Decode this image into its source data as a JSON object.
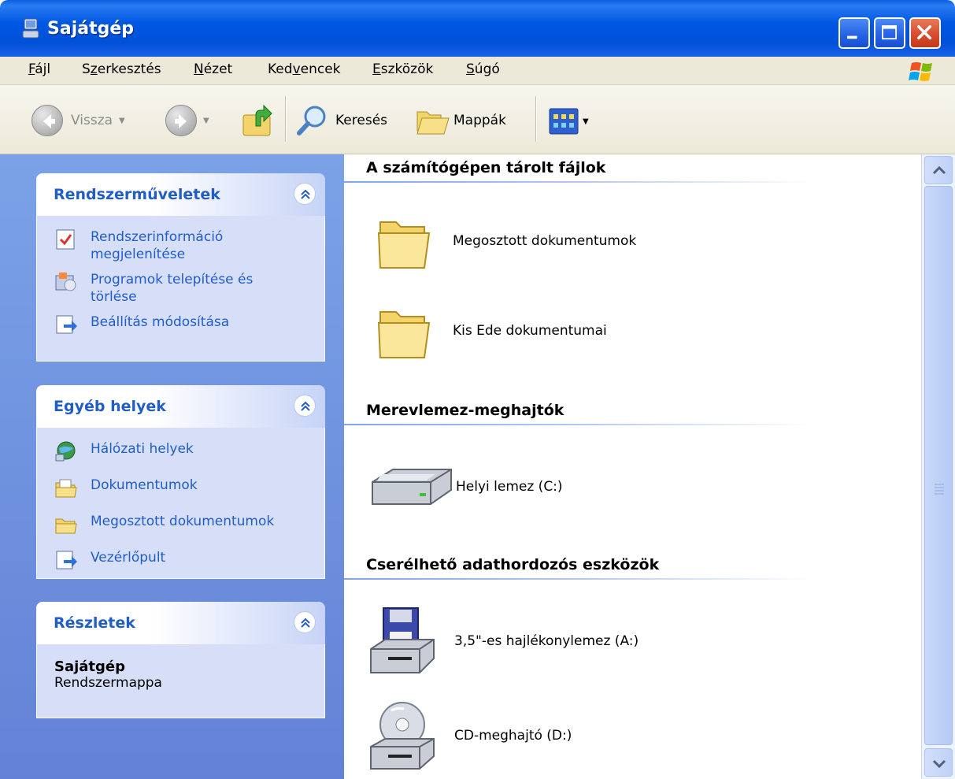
{
  "window": {
    "title": "Sajátgép"
  },
  "menu": [
    {
      "prefix": "",
      "accel": "F",
      "rest": "ájl"
    },
    {
      "prefix": "S",
      "accel": "z",
      "rest": "erkesztés"
    },
    {
      "prefix": "",
      "accel": "N",
      "rest": "ézet"
    },
    {
      "prefix": "Ked",
      "accel": "v",
      "rest": "encek"
    },
    {
      "prefix": "",
      "accel": "E",
      "rest": "szközök"
    },
    {
      "prefix": "",
      "accel": "S",
      "rest": "úgó"
    }
  ],
  "toolbar": {
    "back_label": "Vissza",
    "search_label": "Keresés",
    "folders_label": "Mappák"
  },
  "left": {
    "system_tasks": {
      "title": "Rendszerműveletek",
      "items": [
        {
          "line1": "Rendszerinformáció",
          "line2": "megjelenítése"
        },
        {
          "line1": "Programok telepítése és",
          "line2": "törlése"
        },
        {
          "line1": "Beállítás módosítása",
          "line2": ""
        }
      ]
    },
    "other_places": {
      "title": "Egyéb helyek",
      "items": [
        "Hálózati helyek",
        "Dokumentumok",
        "Megosztott dokumentumok",
        "Vezérlőpult"
      ]
    },
    "details": {
      "title": "Részletek",
      "name": "Sajátgép",
      "type": "Rendszermappa"
    }
  },
  "right": {
    "stored_files": {
      "title": "A számítógépen tárolt fájlok",
      "items": [
        "Megosztott dokumentumok",
        "Kis Ede dokumentumai"
      ]
    },
    "hard_drives": {
      "title": "Merevlemez-meghajtók",
      "items": [
        "Helyi lemez (C:)"
      ]
    },
    "removable": {
      "title": "Cserélhető adathordozós eszközök",
      "items": [
        "3,5\"-es hajlékonylemez (A:)",
        "CD-meghajtó (D:)"
      ]
    }
  },
  "colors": {
    "titlebar": "#0058e3",
    "link": "#215dc6",
    "left_pane": "#7ba2e7",
    "panel_body": "#d6dff7"
  }
}
